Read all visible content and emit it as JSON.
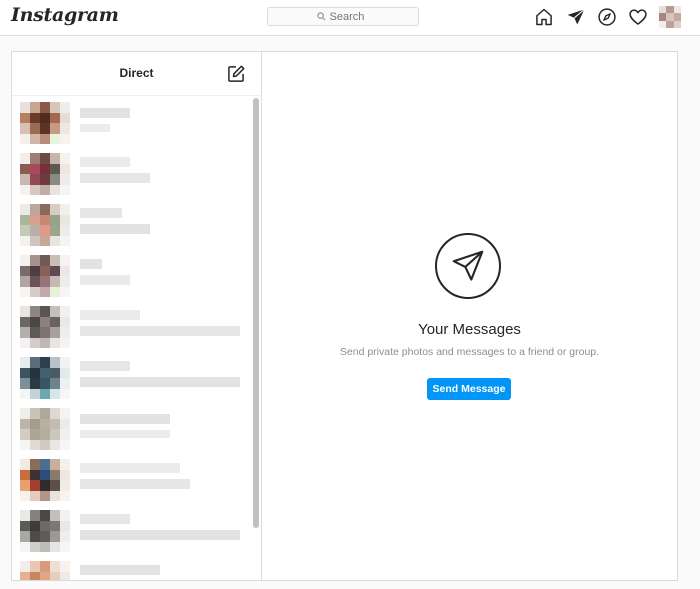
{
  "header": {
    "logo_text": "Instagram",
    "search_placeholder": "Search",
    "icons": [
      "home-icon",
      "direct-icon",
      "explore-icon",
      "activity-icon",
      "profile-avatar"
    ]
  },
  "inbox": {
    "title": "Direct",
    "compose_icon": "new-message-icon",
    "threads": [
      {
        "colors": [
          "#e8e0dc",
          "#c9a48f",
          "#8a5a44",
          "#d7c6bc",
          "#f0ece9",
          "#b87e5e",
          "#6b3b2a",
          "#4e2c20",
          "#a26a50",
          "#e6dcd6",
          "#d8c0b2",
          "#9c6b55",
          "#5c3426",
          "#c79a83",
          "#eee7e2",
          "#f3efed",
          "#d0b6a8",
          "#b88c78",
          "#e8f5dc",
          "#f6f2f0"
        ]
      },
      {
        "colors": [
          "#f2eeec",
          "#9c7e72",
          "#6a4c44",
          "#c7b4aa",
          "#f4f1ef",
          "#8c5b4e",
          "#a84a5c",
          "#7a2f3a",
          "#5a5a52",
          "#ece5e1",
          "#c9b8ad",
          "#914854",
          "#6e3a40",
          "#8a8a7e",
          "#f0ebe8",
          "#f5f2f0",
          "#d6c9c1",
          "#bfaea4",
          "#e9e4e0",
          "#f7f5f3"
        ]
      },
      {
        "colors": [
          "#ede9e6",
          "#b8a89e",
          "#8a6a5c",
          "#d8ccc4",
          "#f2efec",
          "#aab89a",
          "#d9a08e",
          "#c98876",
          "#94a488",
          "#eae6e2",
          "#c2cbb6",
          "#b7b0a6",
          "#e29a86",
          "#9aa58c",
          "#efebe8",
          "#f4f1ef",
          "#cfc5bd",
          "#c5a89a",
          "#e8e4e0",
          "#f6f4f2"
        ]
      },
      {
        "colors": [
          "#f3f0ee",
          "#a4928c",
          "#6e5a58",
          "#cabdb8",
          "#f5f2f0",
          "#7a6a6c",
          "#4e3e44",
          "#8a6058",
          "#5c4c52",
          "#ece7e4",
          "#b3a4a4",
          "#6a5258",
          "#94747a",
          "#c8b8b4",
          "#f0ecea",
          "#f6f3f1",
          "#d8cbc6",
          "#c4a8aa",
          "#e6f2d8",
          "#f7f5f3"
        ]
      },
      {
        "colors": [
          "#e8e6e4",
          "#8c8684",
          "#5a5452",
          "#c4bfbc",
          "#f2f0ee",
          "#6c6664",
          "#4c4644",
          "#8e807a",
          "#6a6260",
          "#ebe8e6",
          "#b4aeac",
          "#5e5856",
          "#7c7470",
          "#a8a09c",
          "#f0eeec",
          "#f4f2f0",
          "#d2cdca",
          "#c0b8b4",
          "#e8e6e4",
          "#f6f4f2"
        ]
      },
      {
        "colors": [
          "#e6ebee",
          "#5c6c78",
          "#2e3e4a",
          "#b8c2c8",
          "#f0f3f5",
          "#3e5260",
          "#24343e",
          "#42606e",
          "#4c5a64",
          "#e4e9ec",
          "#7c9098",
          "#2a3a44",
          "#3a5664",
          "#6e828e",
          "#eef1f3",
          "#f3f5f6",
          "#c4d2d6",
          "#6aa8b4",
          "#d8e6ea",
          "#f5f7f8"
        ]
      },
      {
        "colors": [
          "#efedea",
          "#c8c2b8",
          "#b0a898",
          "#dcd8d2",
          "#f5f3f1",
          "#bcb4a6",
          "#a49c8c",
          "#b8b0a2",
          "#c4bcb0",
          "#ecebe8",
          "#d2ccc4",
          "#aca496",
          "#b4ac9e",
          "#ccc6bc",
          "#f2f0ee",
          "#f6f5f3",
          "#dedad4",
          "#d0cac2",
          "#e8e6e2",
          "#f7f6f4"
        ]
      },
      {
        "colors": [
          "#f2ebe4",
          "#8c6c58",
          "#4a6e94",
          "#c8b09c",
          "#f4f0ec",
          "#c86c3c",
          "#3c3434",
          "#2c4c7c",
          "#8a7c6c",
          "#efe6de",
          "#e8a070",
          "#a04030",
          "#302c2e",
          "#5c5048",
          "#f1ebe6",
          "#f5f1ed",
          "#e4ccba",
          "#b49484",
          "#e8e2dc",
          "#f6f3f0"
        ]
      },
      {
        "colors": [
          "#e9e9e7",
          "#84827e",
          "#4a4846",
          "#c2c0bc",
          "#f2f2f0",
          "#5c5a56",
          "#3e3c3a",
          "#6e6a66",
          "#7a7874",
          "#e9e8e6",
          "#aaa8a4",
          "#4e4c48",
          "#5e5c58",
          "#9c9a96",
          "#efeeec",
          "#f4f4f2",
          "#d0cecb",
          "#bebcb8",
          "#e6e5e3",
          "#f6f6f4"
        ]
      },
      {
        "colors": [
          "#f4eeea",
          "#e8c8b4",
          "#d89c7c",
          "#efe0d6",
          "#f6f2ef",
          "#e4b090",
          "#c8865c",
          "#dca888",
          "#e8cdbc",
          "#f1e9e4",
          "#ecd4c4",
          "#d49474",
          "#dcae94",
          "#e6ccbc",
          "#f3ede9",
          "#f6f2ef",
          "#eadacf",
          "#e2c6b4",
          "#efe6e0",
          "#f7f4f2"
        ]
      }
    ]
  },
  "empty_state": {
    "icon": "paper-plane-icon",
    "title": "Your Messages",
    "subtitle": "Send private photos and messages to a friend or group.",
    "button_label": "Send Message"
  },
  "colors": {
    "accent": "#0095f6",
    "border": "#dbdbdb",
    "text": "#262626",
    "muted": "#8e8e8e"
  }
}
